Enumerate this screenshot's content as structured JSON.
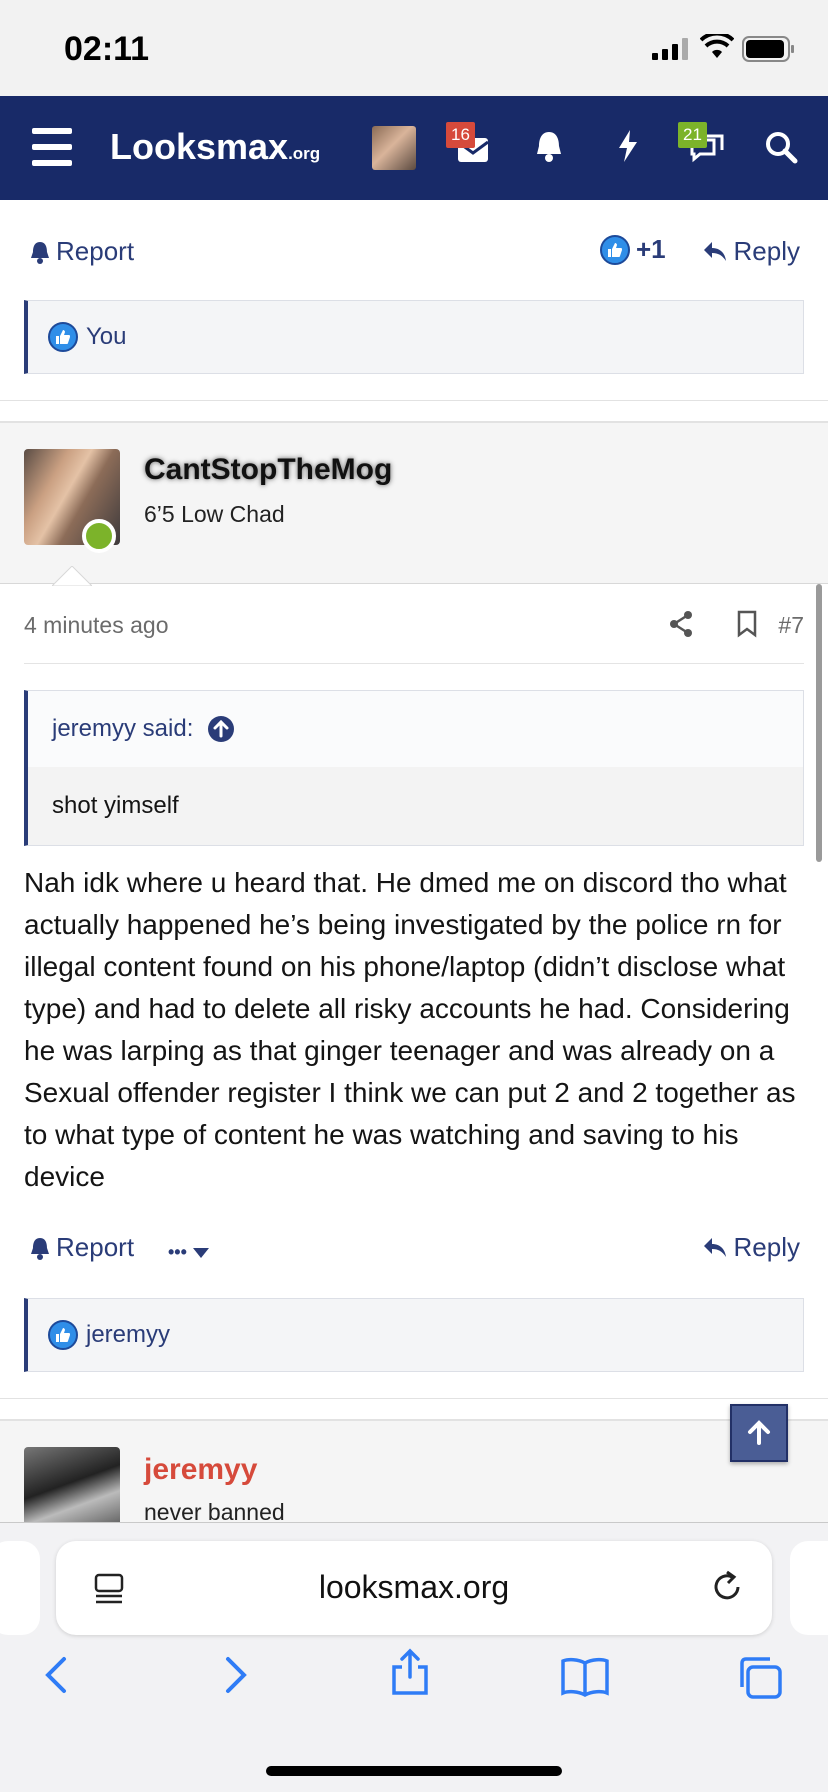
{
  "status_bar": {
    "time": "02:11"
  },
  "header": {
    "logo_main": "Looksmax",
    "logo_suffix": ".org",
    "conversations_badge": "16",
    "alerts_badge": "21"
  },
  "prev_post": {
    "report_label": "Report",
    "reaction_count": "+1",
    "reply_label": "Reply",
    "reacted_by": "You"
  },
  "post": {
    "username": "CantStopTheMog",
    "user_title": "6’5 Low Chad",
    "time": "4 minutes ago",
    "number": "#7",
    "quote_author": "jeremyy said:",
    "quote_text": "shot yimself",
    "body": "Nah idk where u heard that. He dmed me on discord tho what actually happened he’s being investigated by the police rn for illegal content found on his phone/laptop (didn’t disclose what type) and had to delete all risky accounts he had. Considering he was larping as that ginger teenager and was already on a Sexual offender register I think we can put 2 and 2 together as to what type of content he was watching and saving to his device",
    "report_label": "Report",
    "more_label": "•••",
    "reply_label": "Reply",
    "reacted_by": "jeremyy"
  },
  "next_post": {
    "username": "jeremyy",
    "user_title": "never banned"
  },
  "browser": {
    "url": "looksmax.org"
  }
}
